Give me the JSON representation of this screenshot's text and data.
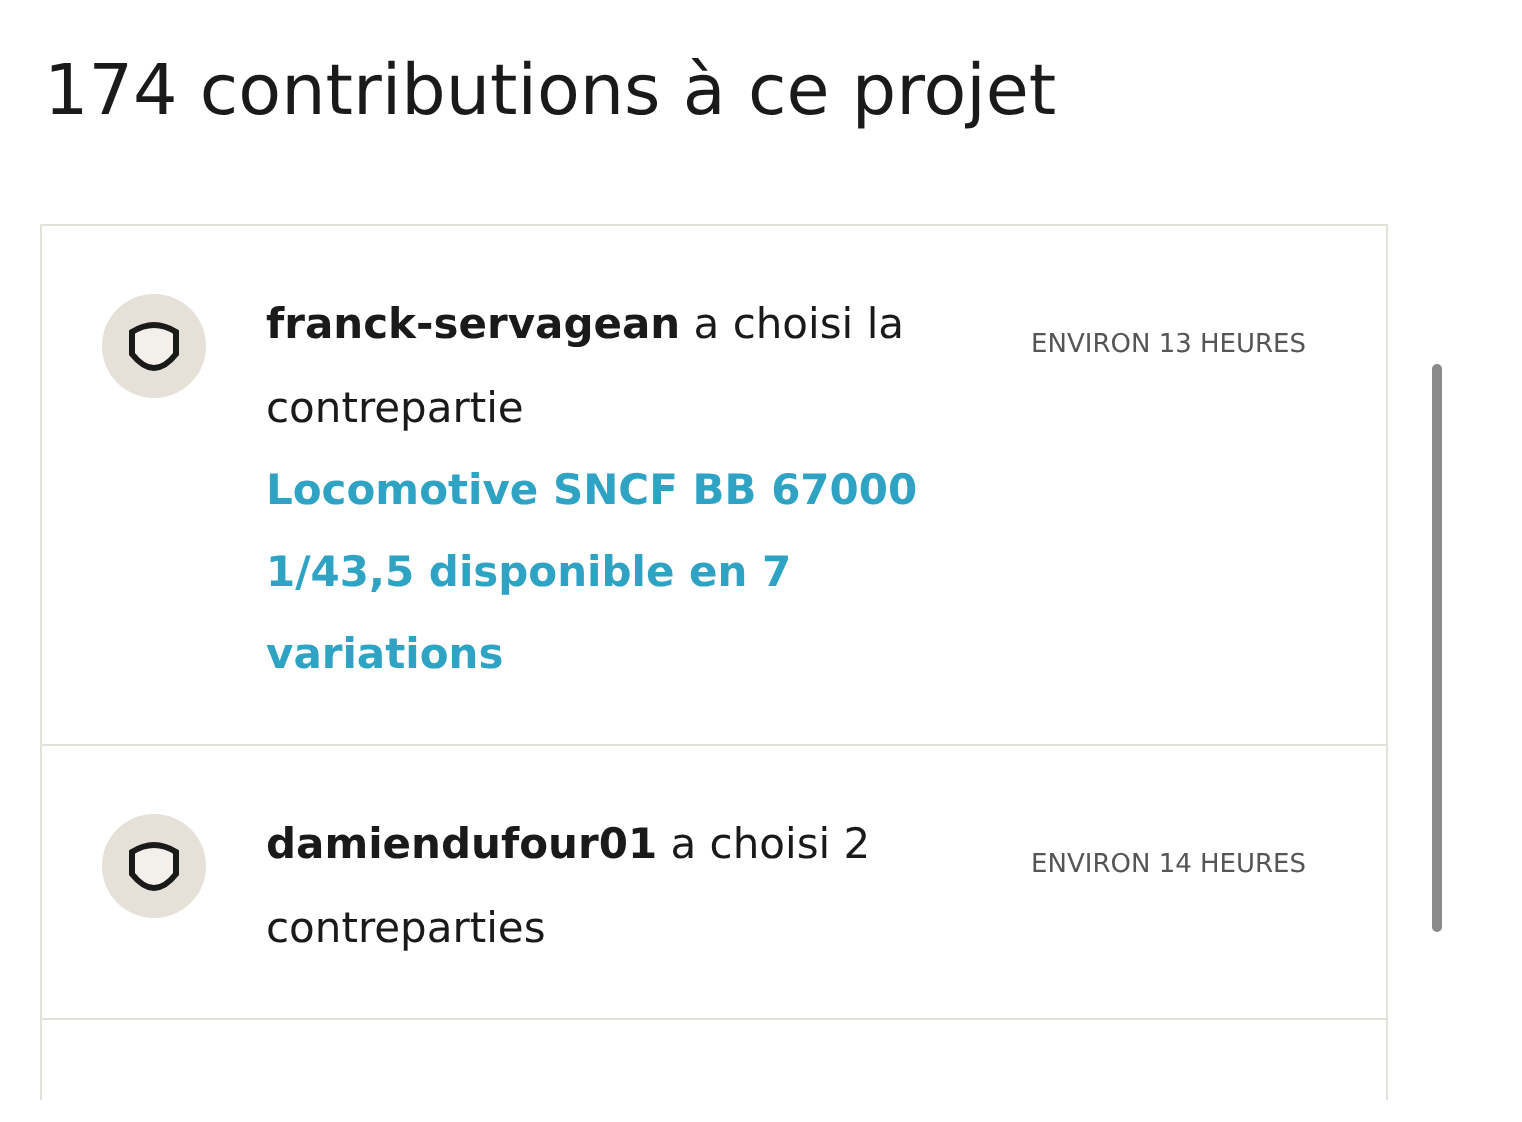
{
  "title": "174 contributions à ce projet",
  "contributions": [
    {
      "text": "**franck-servagean** a choisi la contrepartie",
      "reward": "Locomotive SNCF BB 67000 1/43,5 disponible en 7 variations",
      "time": "ENVIRON 13 HEURES"
    },
    {
      "text": "**damiendufour01** a choisi 2 contreparties",
      "time": "ENVIRON 14 HEURES"
    }
  ]
}
